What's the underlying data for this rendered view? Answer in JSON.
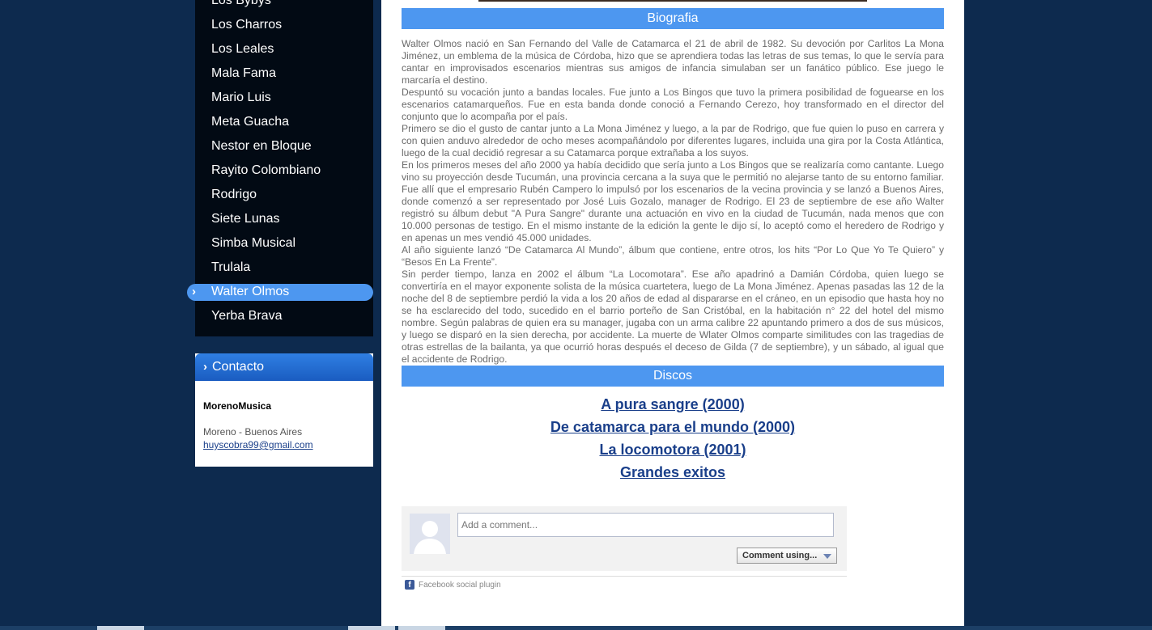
{
  "sidebar": {
    "menu_items": [
      {
        "label": "Los Bybys"
      },
      {
        "label": "Los Charros"
      },
      {
        "label": "Los Leales"
      },
      {
        "label": "Mala Fama"
      },
      {
        "label": "Mario Luis"
      },
      {
        "label": "Meta Guacha"
      },
      {
        "label": "Nestor en Bloque"
      },
      {
        "label": "Rayito Colombiano"
      },
      {
        "label": "Rodrigo"
      },
      {
        "label": "Siete Lunas"
      },
      {
        "label": "Simba Musical"
      },
      {
        "label": "Trulala"
      },
      {
        "label": "Walter Olmos",
        "active": true
      },
      {
        "label": "Yerba Brava"
      }
    ],
    "active_chevron": "›",
    "contact": {
      "title": "Contacto",
      "chevron": "›",
      "name": "MorenoMusica",
      "location": "Moreno - Buenos Aires",
      "email": "huyscobra99@gmail.com"
    }
  },
  "main": {
    "bio_heading": "Biografia",
    "bio_paragraphs": [
      "Walter Olmos nació en San Fernando del Valle de Catamarca el 21 de abril de 1982. Su devoción por Carlitos La Mona Jiménez, un emblema de la música de Córdoba, hizo que se aprendiera todas las letras de sus temas, lo que le servía para cantar en improvisados escenarios mientras sus amigos de infancia simulaban ser un fanático público. Ese juego le marcaría el destino.",
      "Despuntó su vocación junto a bandas locales. Fue junto a Los Bingos que tuvo la primera posibilidad de foguearse en los escenarios catamarqueños. Fue en esta banda donde conoció a Fernando Cerezo, hoy transformado en el director del conjunto que lo acompaña por el país.",
      "Primero se dio el gusto de cantar junto a La Mona Jiménez y luego, a la par de Rodrigo, que fue quien lo puso en carrera y con quien anduvo alrededor de ocho meses acompañándolo por diferentes lugares, incluida una gira por la Costa Atlántica, luego de la cual decidió regresar a su Catamarca porque extrañaba a los suyos.",
      "En los primeros meses del año 2000 ya había decidido que sería junto a Los Bingos que se realizaría como cantante. Luego vino su proyección desde Tucumán, una provincia cercana a la suya que le permitió no alejarse tanto de su entorno familiar. Fue allí que el empresario Rubén Campero lo impulsó por los escenarios de la vecina provincia y se lanzó a Buenos Aires, donde comenzó a ser representado por José Luis Gozalo, manager de Rodrigo. El 23 de septiembre de ese año Walter registró su álbum debut \"A Pura Sangre\" durante una actuación en vivo en la ciudad de Tucumán, nada menos que con 10.000 personas de testigo. En el mismo instante de la edición la gente le dijo sí, lo aceptó como el heredero de Rodrigo y en apenas un mes vendió 45.000 unidades.",
      "Al año siguiente lanzó “De Catamarca Al Mundo”, álbum que contiene, entre otros, los hits “Por Lo Que Yo Te Quiero” y “Besos En La Frente”.",
      "Sin perder tiempo, lanza en 2002 el álbum “La Locomotara”. Ese año apadrinó a Damián Córdoba, quien luego se convertiría en el mayor exponente solista de la música cuartetera, luego de La Mona Jiménez. Apenas pasadas las 12 de la noche del 8 de septiembre perdió la vida a los 20 años de edad al dispararse en el cráneo, en un episodio que hasta hoy no se ha esclarecido del todo, sucedido en el barrio porteño de San Cristóbal, en la habitación n° 22 del hotel del mismo nombre. Según palabras de quien era su manager, jugaba con un arma calibre 22 apuntando primero a dos de sus músicos, y luego se disparó en la sien derecha, por accidente. La muerte de Wlater Olmos comparte similitudes con las tragedias de otras estrellas de la bailanta, ya que ocurrió horas después el deceso de Gilda (7 de septiembre), y un sábado, al igual que el accidente de Rodrigo."
    ],
    "discs_heading": "Discos",
    "discs": [
      {
        "label": "A pura sangre (2000)"
      },
      {
        "label": "De catamarca para el mundo (2000)"
      },
      {
        "label": "La locomotora (2001)"
      },
      {
        "label": "Grandes exitos"
      }
    ]
  },
  "facebook": {
    "comment_placeholder": "Add a comment...",
    "comment_using_label": "Comment using...",
    "plugin_label": "Facebook social plugin",
    "logo_letter": "f"
  },
  "colors": {
    "page_background": "#0d2a4e",
    "sidebar_background": "#020a14",
    "accent_blue": "#4d97f0",
    "link_blue": "#1a3f8a",
    "body_text_gray": "#6a6a6a"
  }
}
